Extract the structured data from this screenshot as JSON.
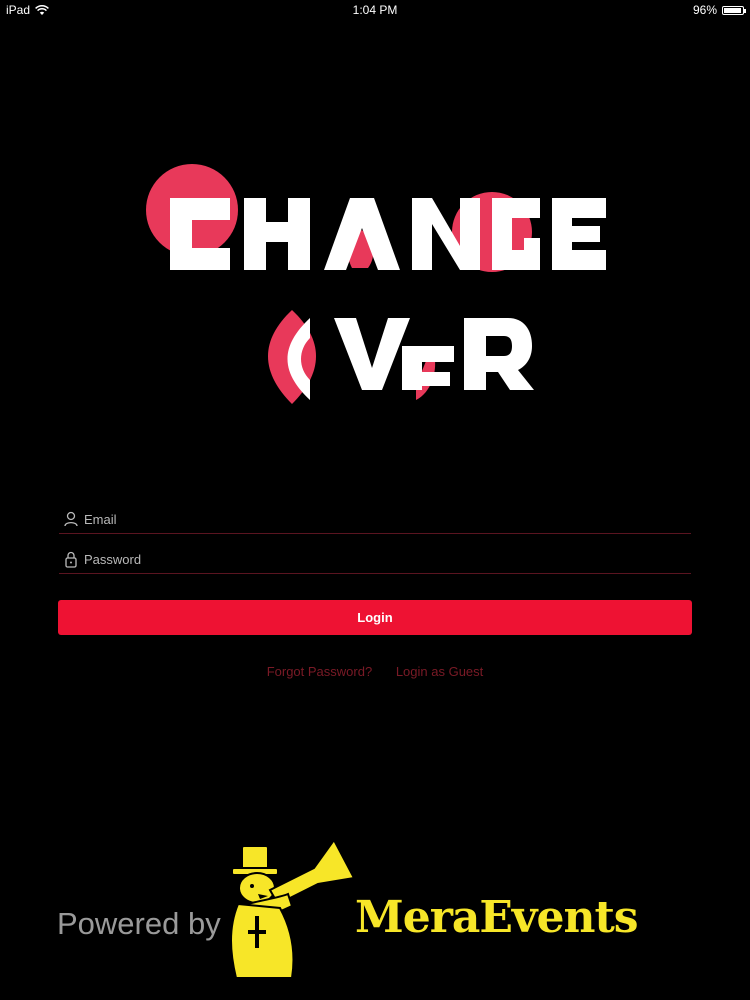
{
  "status_bar": {
    "device": "iPad",
    "time": "1:04 PM",
    "battery": "96%",
    "battery_level": 0.96
  },
  "app": {
    "logo_text": "ChangeOver",
    "brand_color": "#ee1233",
    "logo_accent_color": "#e8395a"
  },
  "login_form": {
    "email_placeholder": "Email",
    "password_placeholder": "Password",
    "login_label": "Login",
    "forgot_password_label": "Forgot Password?",
    "guest_login_label": "Login as Guest"
  },
  "footer": {
    "powered_by": "Powered by",
    "brand": "MeraEvents",
    "brand_color": "#f7e628"
  },
  "icons": [
    "wifi-icon",
    "battery-icon",
    "user-icon",
    "lock-icon",
    "megaphone-mascot-icon"
  ]
}
